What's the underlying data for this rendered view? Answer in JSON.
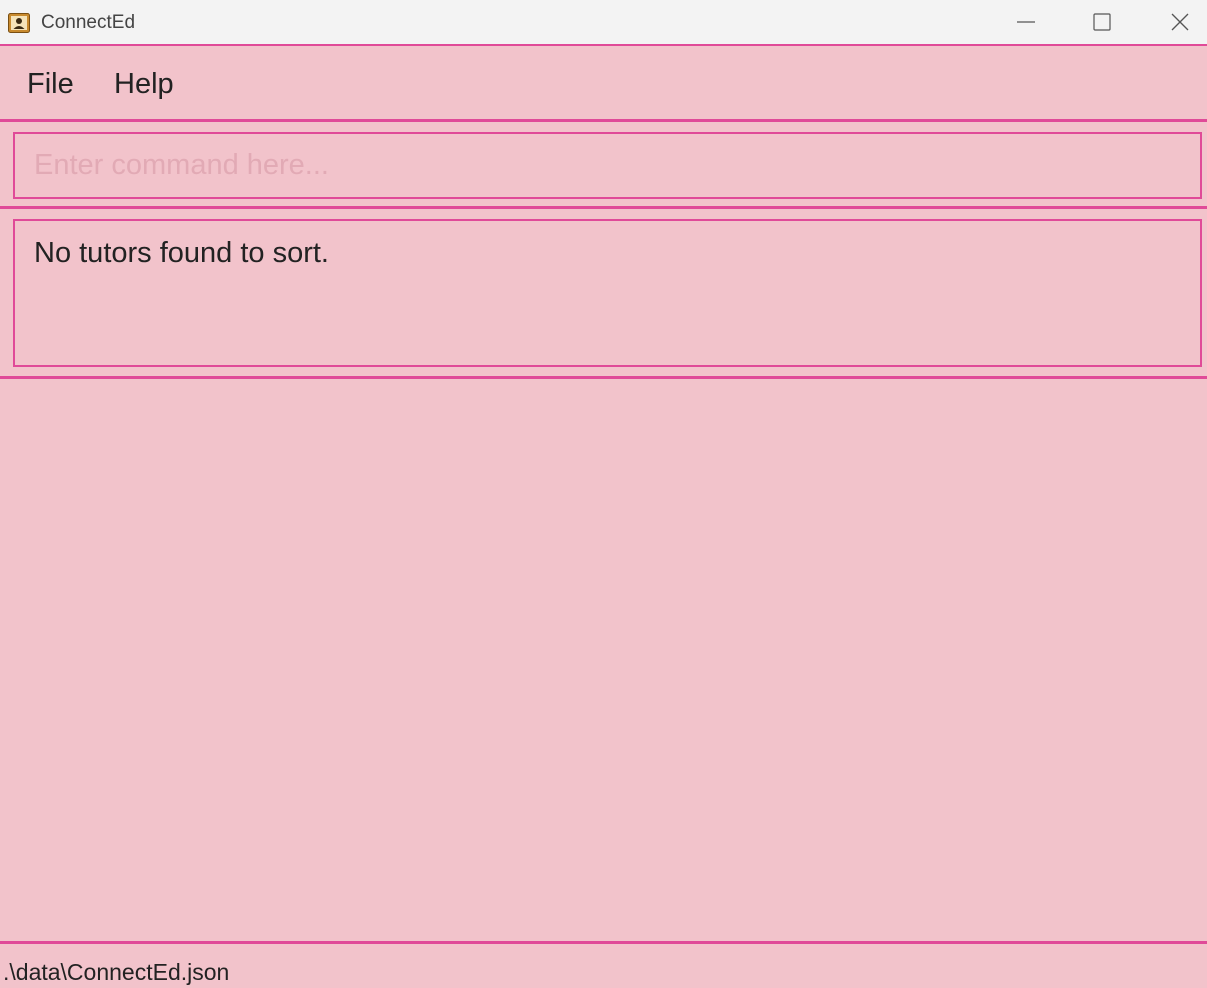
{
  "window": {
    "title": "ConnectEd",
    "controls": {
      "minimize_icon": "minimize-icon",
      "maximize_icon": "maximize-icon",
      "close_icon": "close-icon"
    }
  },
  "menu": {
    "items": [
      {
        "label": "File"
      },
      {
        "label": "Help"
      }
    ]
  },
  "command": {
    "value": "",
    "placeholder": "Enter command here..."
  },
  "result": {
    "message": "No tutors found to sort."
  },
  "status": {
    "file_path": ".\\data\\ConnectEd.json"
  },
  "colors": {
    "background": "#f2c3cb",
    "accent_border": "#e04a98",
    "titlebar": "#f3f3f3",
    "placeholder_text": "#e2aab5",
    "text": "#222222"
  }
}
